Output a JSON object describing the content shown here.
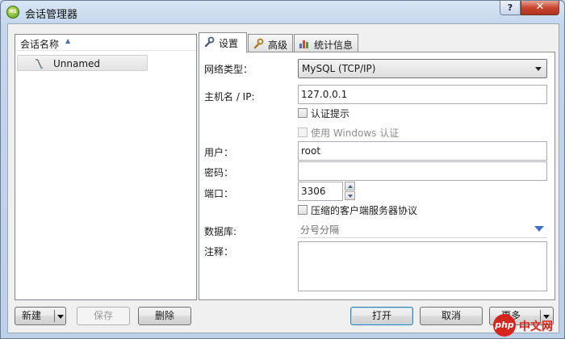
{
  "window": {
    "title": "会话管理器",
    "app_icon_text": "HS",
    "help_label": "?",
    "close_label": "✕"
  },
  "session_list": {
    "header_label": "会话名称",
    "sort_glyph": "▲",
    "items": [
      {
        "name": "Unnamed",
        "icon": "session-icon"
      }
    ]
  },
  "tabs": [
    {
      "label": "设置",
      "icon": "wrench-icon",
      "active": true
    },
    {
      "label": "高级",
      "icon": "wrench-icon",
      "active": false
    },
    {
      "label": "统计信息",
      "icon": "bar-chart-icon",
      "active": false
    }
  ],
  "settings": {
    "network_type_label": "网络类型：",
    "network_type_value": "MySQL (TCP/IP)",
    "host_label": "主机名 / IP:",
    "host_value": "127.0.0.1",
    "auth_prompt_label": "认证提示",
    "auth_prompt_checked": false,
    "windows_auth_label": "使用 Windows 认证",
    "windows_auth_checked": false,
    "windows_auth_enabled": false,
    "user_label": "用户：",
    "user_value": "root",
    "password_label": "密码：",
    "password_value": "",
    "port_label": "端口：",
    "port_value": "3306",
    "compress_label": "压缩的客户端服务器协议",
    "compress_checked": false,
    "database_label": "数据库:",
    "database_placeholder": "分号分隔",
    "notes_label": "注释：",
    "notes_value": ""
  },
  "buttons": {
    "new_label": "新建",
    "save_label": "保存",
    "delete_label": "删除",
    "open_label": "打开",
    "cancel_label": "取消",
    "more_label": "更多"
  },
  "watermark": {
    "logo_text": "php",
    "site_text": "中文网"
  },
  "colors": {
    "accent": "#3c7fb1",
    "close_red": "#c8452e",
    "watermark_red": "#d6251d"
  }
}
